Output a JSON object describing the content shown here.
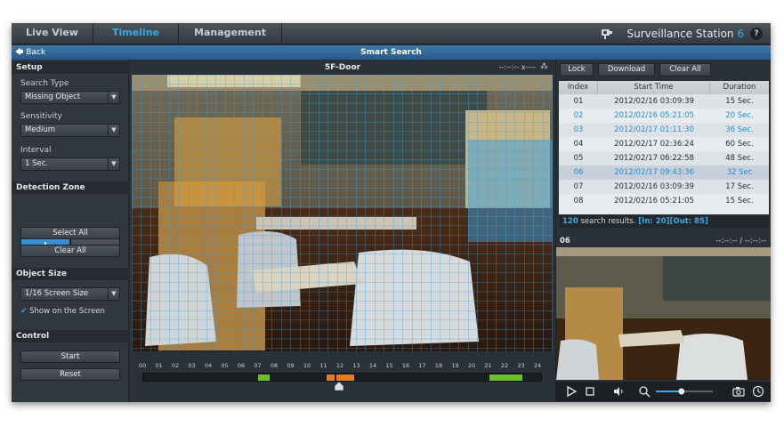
{
  "nav": {
    "tabs": [
      {
        "label": "Live View",
        "active": false
      },
      {
        "label": "Timeline",
        "active": true
      },
      {
        "label": "Management",
        "active": false
      }
    ],
    "brand": "Surveillance Station",
    "brand_version": "6",
    "help_label": "?"
  },
  "titlebar": {
    "back_label": "Back",
    "title": "Smart Search"
  },
  "setup": {
    "heading": "Setup",
    "search_type_label": "Search Type",
    "search_type_value": "Missing Object",
    "sensitivity_label": "Sensitivity",
    "sensitivity_value": "Medium",
    "interval_label": "Interval",
    "interval_value": "1 Sec."
  },
  "detection_zone": {
    "heading": "Detection Zone",
    "add_label": "+",
    "remove_label": "−",
    "select_all_label": "Select All",
    "clear_all_label": "Clear All"
  },
  "object_size": {
    "heading": "Object Size",
    "value": "1/16 Screen Size",
    "show_label": "Show on the Screen",
    "show_checked": true
  },
  "control": {
    "heading": "Control",
    "start_label": "Start",
    "reset_label": "Reset"
  },
  "camera": {
    "name": "5F-Door",
    "time": "--:--:-- x----",
    "spinner_icon": "loading-icon"
  },
  "timeline": {
    "hours": [
      "00",
      "01",
      "02",
      "03",
      "04",
      "05",
      "06",
      "07",
      "08",
      "09",
      "10",
      "11",
      "12",
      "13",
      "14",
      "15",
      "16",
      "17",
      "18",
      "19",
      "20",
      "21",
      "22",
      "23",
      "24"
    ],
    "green_segments_hours": [
      [
        6.95,
        7.6
      ],
      [
        20.9,
        22.85
      ]
    ],
    "orange_segments_hours": [
      [
        11.05,
        11.55
      ],
      [
        11.65,
        12.75
      ]
    ],
    "playhead_hour": 11.8
  },
  "results": {
    "lock_label": "Lock",
    "download_label": "Download",
    "clear_all_label": "Clear All",
    "columns": [
      "Index",
      "Start Time",
      "Duration"
    ],
    "rows": [
      {
        "index": "01",
        "start": "2012/02/16 03:09:39",
        "duration": "15 Sec.",
        "highlight": false,
        "selected": false
      },
      {
        "index": "02",
        "start": "2012/02/16 05:21:05",
        "duration": "20 Sec.",
        "highlight": true,
        "selected": false
      },
      {
        "index": "03",
        "start": "2012/02/17 01:11:30",
        "duration": "36 Sec.",
        "highlight": true,
        "selected": false
      },
      {
        "index": "04",
        "start": "2012/02/17 02:36:24",
        "duration": "60 Sec.",
        "highlight": false,
        "selected": false
      },
      {
        "index": "05",
        "start": "2012/02/17 06:22:58",
        "duration": "48 Sec.",
        "highlight": false,
        "selected": false
      },
      {
        "index": "06",
        "start": "2012/02/17 09:43:36",
        "duration": "32 Sec",
        "highlight": true,
        "selected": true
      },
      {
        "index": "07",
        "start": "2012/02/16 03:09:39",
        "duration": "17 Sec.",
        "highlight": false,
        "selected": false
      },
      {
        "index": "08",
        "start": "2012/02/16 05:21:05",
        "duration": "15 Sec.",
        "highlight": false,
        "selected": false
      }
    ],
    "summary_count": "120",
    "summary_text": " search results. ",
    "summary_in": "[In: 20]",
    "summary_out": "[Out: 85]"
  },
  "preview": {
    "id": "06",
    "time": "--:--:-- / --:--:--",
    "volume_level": 0.45
  },
  "colors": {
    "accent": "#39a9e6",
    "grid": "#3ea0e0",
    "zone_orange": "#e8a53a",
    "zone_blue": "#3b9de0"
  }
}
